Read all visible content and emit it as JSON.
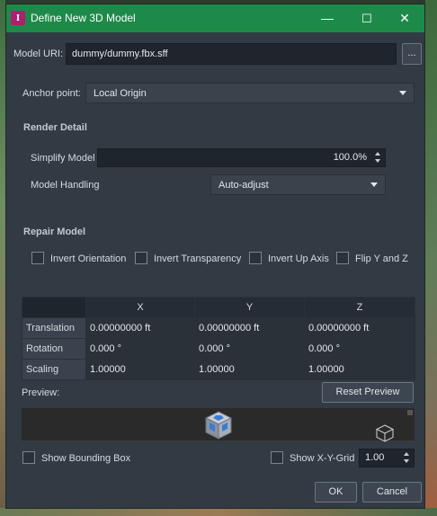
{
  "window": {
    "title": "Define New 3D Model",
    "app_icon_letter": "I",
    "controls": {
      "minimize": "—",
      "maximize": "☐",
      "close": "✕"
    }
  },
  "model_uri": {
    "label": "Model URI:",
    "value": "dummy/dummy.fbx.sff",
    "browse_label": "..."
  },
  "anchor": {
    "label": "Anchor point:",
    "value": "Local Origin"
  },
  "render_detail": {
    "heading": "Render Detail",
    "simplify_label": "Simplify Model",
    "simplify_value": "100.0%",
    "handling_label": "Model Handling",
    "handling_value": "Auto-adjust"
  },
  "repair": {
    "heading": "Repair Model",
    "options": [
      "Invert Orientation",
      "Invert Transparency",
      "Invert Up Axis",
      "Flip Y and Z"
    ]
  },
  "transform": {
    "columns": [
      "X",
      "Y",
      "Z"
    ],
    "rows": [
      {
        "label": "Translation",
        "values": [
          "0.00000000 ft",
          "0.00000000 ft",
          "0.00000000 ft"
        ]
      },
      {
        "label": "Rotation",
        "values": [
          "0.000 °",
          "0.000 °",
          "0.000 °"
        ]
      },
      {
        "label": "Scaling",
        "values": [
          "1.00000",
          "1.00000",
          "1.00000"
        ]
      }
    ]
  },
  "preview": {
    "label": "Preview:",
    "reset_label": "Reset Preview"
  },
  "options": {
    "bounding_box_label": "Show Bounding Box",
    "grid_label": "Show X-Y-Grid",
    "grid_value": "1.00"
  },
  "buttons": {
    "ok": "OK",
    "cancel": "Cancel"
  },
  "colors": {
    "titlebar": "#1e8a4a",
    "dialog_bg": "#323a44",
    "field_bg": "#1f252d"
  }
}
